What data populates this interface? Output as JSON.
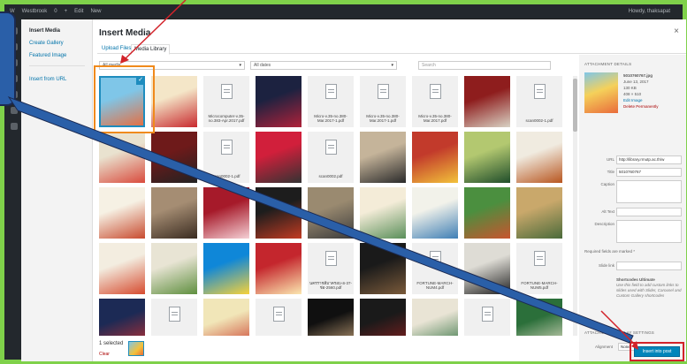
{
  "adminbar": {
    "items": [
      "W",
      "Westbrook",
      "0",
      "+",
      "Edit",
      "New"
    ],
    "right": "Howdy, thaksapat"
  },
  "menu": {
    "items": [
      {
        "label": "Insert Media",
        "active": true
      },
      {
        "label": "Create Gallery",
        "active": false
      },
      {
        "label": "Featured Image",
        "active": false
      }
    ],
    "from_url": "Insert from URL"
  },
  "modal": {
    "title": "Insert Media",
    "close": "×"
  },
  "tabs": [
    {
      "label": "Upload Files"
    },
    {
      "label": "Media Library"
    }
  ],
  "filters": {
    "type": "All media",
    "date": "All dates",
    "search_placeholder": "Search"
  },
  "tiles": [
    {
      "kind": "img",
      "c1": "#7fc6e8",
      "c2": "#e96b3b",
      "label": "",
      "selected": true
    },
    {
      "kind": "img",
      "c1": "#f4e6c8",
      "c2": "#c8292e",
      "label": ""
    },
    {
      "kind": "doc",
      "name": "Microcomputer-v.35-no.383-Apr.2017.pdf"
    },
    {
      "kind": "img",
      "c1": "#1c2240",
      "c2": "#b0223a",
      "label": ""
    },
    {
      "kind": "doc",
      "name": "Micro-v.35-no.380-Mar.2017-1.pdf"
    },
    {
      "kind": "doc",
      "name": "Micro-v.35-no.380-Mar.2017-1.pdf"
    },
    {
      "kind": "doc",
      "name": "Micro-v.35-no.380-Mar.2017.pdf"
    },
    {
      "kind": "img",
      "c1": "#8e1d1d",
      "c2": "#d9d2c4",
      "label": ""
    },
    {
      "kind": "doc",
      "name": "scan0002-1.pdf"
    },
    {
      "kind": "img",
      "c1": "#e9e2cf",
      "c2": "#d94b3d",
      "label": ""
    },
    {
      "kind": "img",
      "c1": "#6e1a1a",
      "c2": "#222",
      "label": ""
    },
    {
      "kind": "doc",
      "name": "scan0002-1.pdf"
    },
    {
      "kind": "img",
      "c1": "#d11f3b",
      "c2": "#333",
      "label": ""
    },
    {
      "kind": "doc",
      "name": "scan0002.pdf"
    },
    {
      "kind": "img",
      "c1": "#c5b49a",
      "c2": "#2a2a2a",
      "label": ""
    },
    {
      "kind": "img",
      "c1": "#c23a2b",
      "c2": "#f2c23a",
      "label": ""
    },
    {
      "kind": "img",
      "c1": "#b3c870",
      "c2": "#1f4d2a",
      "label": ""
    },
    {
      "kind": "img",
      "c1": "#f0ebe0",
      "c2": "#b8561f",
      "label": ""
    },
    {
      "kind": "img",
      "c1": "#f6f1e4",
      "c2": "#c84b2f",
      "label": ""
    },
    {
      "kind": "img",
      "c1": "#a58d73",
      "c2": "#3a2b20",
      "label": ""
    },
    {
      "kind": "img",
      "c1": "#a61a2a",
      "c2": "#f5d0d5",
      "label": ""
    },
    {
      "kind": "img",
      "c1": "#1d1d1d",
      "c2": "#c23b22",
      "label": ""
    },
    {
      "kind": "img",
      "c1": "#9a8a70",
      "c2": "#3c3c3c",
      "label": ""
    },
    {
      "kind": "img",
      "c1": "#f4ecd8",
      "c2": "#5a8f5a",
      "label": ""
    },
    {
      "kind": "img",
      "c1": "#f2f2ea",
      "c2": "#3f7fb5",
      "label": ""
    },
    {
      "kind": "img",
      "c1": "#4b8f3f",
      "c2": "#c9542e",
      "label": ""
    },
    {
      "kind": "img",
      "c1": "#c9a86b",
      "c2": "#4a6a3a",
      "label": ""
    },
    {
      "kind": "img",
      "c1": "#f3ede0",
      "c2": "#d64b2f",
      "label": ""
    },
    {
      "kind": "img",
      "c1": "#e8e4d4",
      "c2": "#5f8f3f",
      "label": ""
    },
    {
      "kind": "img",
      "c1": "#0f87d8",
      "c2": "#f7d23a",
      "label": ""
    },
    {
      "kind": "img",
      "c1": "#c4262d",
      "c2": "#fbe7b0",
      "label": ""
    },
    {
      "kind": "doc",
      "name": "นครราชสีมาครอบ-อ-37-ช่อ-2560.pdf"
    },
    {
      "kind": "img",
      "c1": "#1a1a1a",
      "c2": "#7a5a3a",
      "label": ""
    },
    {
      "kind": "doc",
      "name": "FORTUNE-MARCH-NUM4.pdf"
    },
    {
      "kind": "img",
      "c1": "#dedcd5",
      "c2": "#222",
      "label": ""
    },
    {
      "kind": "doc",
      "name": "FORTUNE-MARCH-NUM5.pdf"
    },
    {
      "kind": "img",
      "c1": "#1c2a55",
      "c2": "#c23030",
      "label": ""
    },
    {
      "kind": "doc",
      "name": "FORTUNE-"
    },
    {
      "kind": "img",
      "c1": "#f1e6b8",
      "c2": "#c93b2b",
      "label": ""
    },
    {
      "kind": "doc",
      "name": "FORTUNE-"
    },
    {
      "kind": "img",
      "c1": "#101010",
      "c2": "#c7a47a",
      "label": ""
    },
    {
      "kind": "img",
      "c1": "#1a1a1a",
      "c2": "#8a1f1f",
      "label": ""
    },
    {
      "kind": "img",
      "c1": "#e9e4d5",
      "c2": "#2f6f3f",
      "label": ""
    },
    {
      "kind": "doc",
      "name": "วารสารอสมท 1.pdf"
    },
    {
      "kind": "img",
      "c1": "#2b6f3a",
      "c2": "#e5e0c8",
      "label": ""
    }
  ],
  "selection": {
    "count_text": "1 selected",
    "clear": "Clear"
  },
  "details": {
    "heading": "ATTACHMENT DETAILS",
    "filename": "5010760767.jpg",
    "date": "June 13, 2017",
    "size": "130 KB",
    "dims": "408 × 510",
    "edit": "Edit Image",
    "delete": "Delete Permanently",
    "fields": [
      {
        "label": "URL",
        "value": "http://library.rmutp.ac.th/w"
      },
      {
        "label": "Title",
        "value": "5010760767"
      },
      {
        "label": "Caption",
        "value": ""
      },
      {
        "label": "Alt Text",
        "value": ""
      },
      {
        "label": "Description",
        "value": ""
      }
    ],
    "required_note": "Required fields are marked *",
    "slide_label": "Slide link",
    "shortcodes_title": "Shortcodes Ultimate",
    "shortcodes_text": "Use this field to add custom links to slides used with Slider, Carousel and Custom Gallery shortcodes",
    "display_heading": "ATTACHMENT DISPLAY SETTINGS",
    "align_label": "Alignment",
    "align_value": "None"
  },
  "insert_label": "Insert into post",
  "colors": {
    "accent": "#0085ba",
    "highlight": "#f08a1c",
    "callout": "#2a5fa8",
    "arrow": "#d2232a",
    "border": "#7fd14a"
  }
}
